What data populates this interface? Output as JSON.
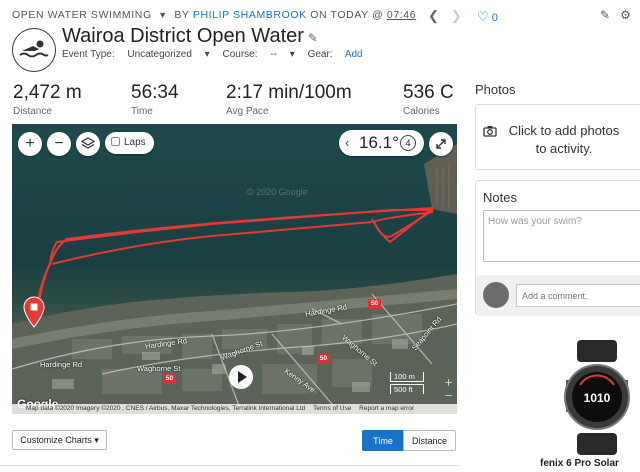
{
  "header": {
    "activity_type": "OPEN WATER SWIMMING",
    "by": "BY",
    "user": "PHILIP SHAMBROOK",
    "on": "ON TODAY @",
    "time": "07:46",
    "like_count": "0"
  },
  "activity": {
    "title": "Wairoa District Open Water",
    "event_type_label": "Event Type:",
    "event_type_value": "Uncategorized",
    "course_label": "Course:",
    "course_value": "--",
    "gear_label": "Gear:",
    "gear_link": "Add"
  },
  "stats": [
    {
      "value": "2,472 m",
      "label": "Distance"
    },
    {
      "value": "56:34",
      "label": "Time"
    },
    {
      "value": "2:17 min/100m",
      "label": "Avg Pace"
    },
    {
      "value": "536 C",
      "label": "Calories"
    }
  ],
  "map": {
    "laps_label": "Laps",
    "temperature": "16.1°",
    "temp_badge": "4",
    "watermark": "© 2020 Google",
    "roads": [
      "Hardinge Rd",
      "Hardinge Rd",
      "Hardinge Rd",
      "Waghorne St",
      "Waghorne St",
      "Waghorne St",
      "Kenny Ave",
      "Seapoint Rd"
    ],
    "route_shield": "50",
    "scale_top": "100 m",
    "scale_bottom": "500 ft",
    "google_logo": "Google",
    "attribution": "Map data ©2020 Imagery ©2020 , CNES / Airbus, Maxar Technologies, Terralink International Ltd",
    "terms": "Terms of Use",
    "report": "Report a map error",
    "colors": {
      "track": "#e53935",
      "water": "#1f4a4d"
    }
  },
  "sidebar": {
    "photos_heading": "Photos",
    "photos_cta": "Click to add photos to activity.",
    "notes_heading": "Notes",
    "notes_placeholder": "How was your swim?",
    "comment_placeholder": "Add a comment.",
    "device_name": "fenix 6 Pro Solar",
    "watch_display": "1010"
  },
  "controls": {
    "customize_label": "Customize Charts",
    "time_tab": "Time",
    "distance_tab": "Distance"
  },
  "icons": [
    "swimmer-icon",
    "pencil-icon",
    "heart-icon",
    "edit-icon",
    "gear-icon",
    "zoom-in-icon",
    "zoom-out-icon",
    "layers-icon",
    "expand-icon",
    "camera-icon",
    "play-icon",
    "start-pin-icon"
  ]
}
